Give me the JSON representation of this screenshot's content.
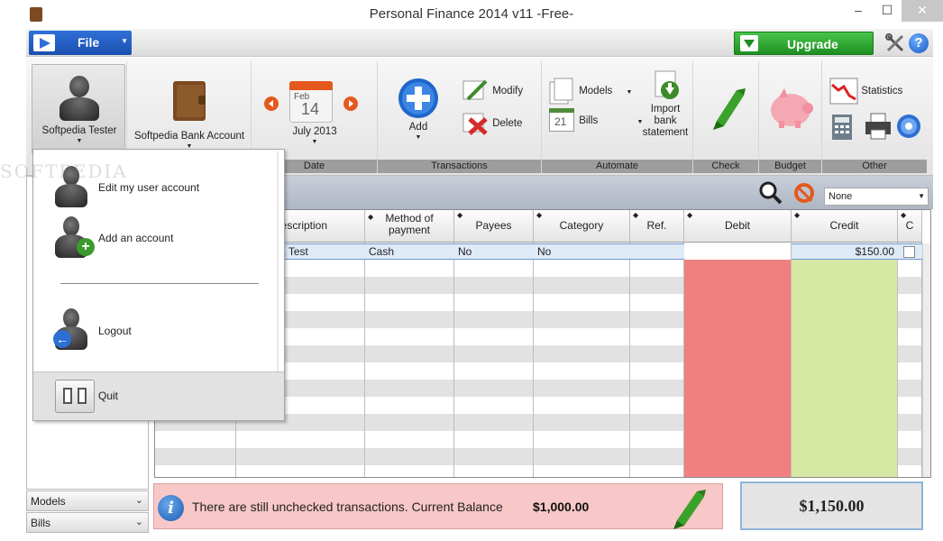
{
  "window": {
    "title": "Personal Finance 2014 v11 -Free-",
    "minimize": "–",
    "maximize": "☐",
    "close": "✕"
  },
  "menubar": {
    "file_label": "File",
    "upgrade_label": "Upgrade",
    "help_glyph": "?"
  },
  "ribbon": {
    "user_label": "Softpedia Tester",
    "account_label": "Softpedia Bank Account",
    "date": {
      "month": "Feb",
      "day": "14",
      "label": "July 2013",
      "group": "Date"
    },
    "transactions": {
      "add": "Add",
      "modify": "Modify",
      "delete": "Delete",
      "group": "Transactions"
    },
    "automate": {
      "models": "Models",
      "bills": "Bills",
      "bills_day": "21",
      "import": "Import bank statement",
      "group": "Automate"
    },
    "check_group": "Check",
    "budget_group": "Budget",
    "other": {
      "statistics": "Statistics",
      "group": "Other"
    }
  },
  "user_menu": {
    "edit": "Edit my user account",
    "add": "Add an account",
    "logout": "Logout",
    "quit": "Quit"
  },
  "watermark": "SOFTPEDIA",
  "filter": {
    "value": "None"
  },
  "sidebar": {
    "models": "Models",
    "bills": "Bills"
  },
  "grid": {
    "headers": {
      "description": "Description",
      "method": "Method of payment",
      "payees": "Payees",
      "category": "Category",
      "ref": "Ref.",
      "debit": "Debit",
      "credit": "Credit",
      "checked": "C"
    },
    "row": {
      "description": "Softpedia Test",
      "method": "Cash",
      "payees": "No",
      "category": "No",
      "ref": "",
      "debit": "",
      "credit": "$150.00"
    }
  },
  "status": {
    "message": "There are still unchecked transactions. Current Balance",
    "current_balance": "$1,000.00",
    "balance": "$1,150.00"
  },
  "colors": {
    "accent": "#1a4fae",
    "upgrade": "#1e8f22",
    "debit": "#f08080",
    "credit": "#d6e8a4",
    "warning": "#f8c7c7"
  }
}
